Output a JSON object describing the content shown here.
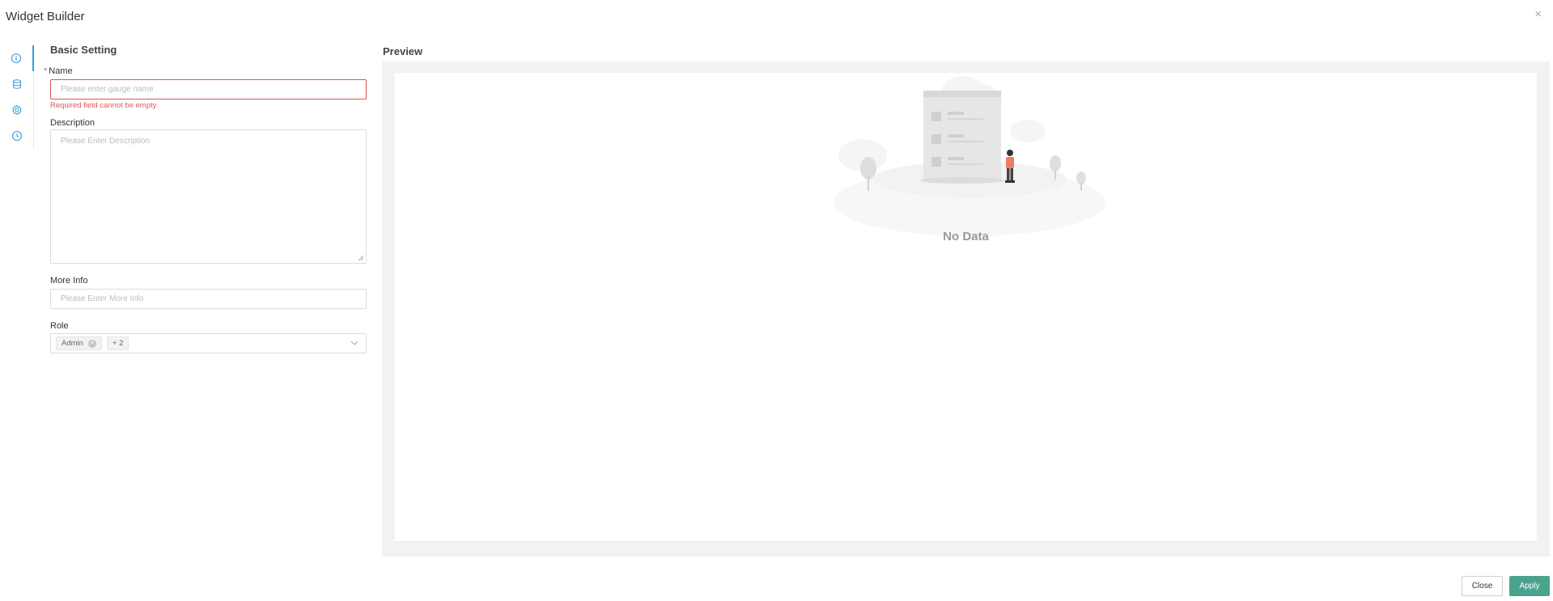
{
  "header": {
    "title": "Widget Builder",
    "close_icon": "×"
  },
  "sidenav": {
    "items": [
      "info-icon",
      "database-icon",
      "settings-gear-icon",
      "clock-icon"
    ],
    "active_index": 0,
    "accent": "#3a9bd5"
  },
  "form": {
    "section_title": "Basic Setting",
    "name": {
      "label": "Name",
      "required_mark": "*",
      "placeholder": "Please enter gauge name",
      "error": "Required field cannot be empty"
    },
    "description": {
      "label": "Description",
      "placeholder": "Please Enter Description"
    },
    "more_info": {
      "label": "More Info",
      "placeholder": "Please Enter More Info"
    },
    "role": {
      "label": "Role",
      "selected_tag": "Admin",
      "more_tag": "+ 2"
    }
  },
  "preview": {
    "title": "Preview",
    "empty_text": "No Data"
  },
  "footer": {
    "close_label": "Close",
    "apply_label": "Apply"
  },
  "colors": {
    "error": "#e05555",
    "primary": "#4aa38d",
    "accent": "#3a9bd5"
  }
}
